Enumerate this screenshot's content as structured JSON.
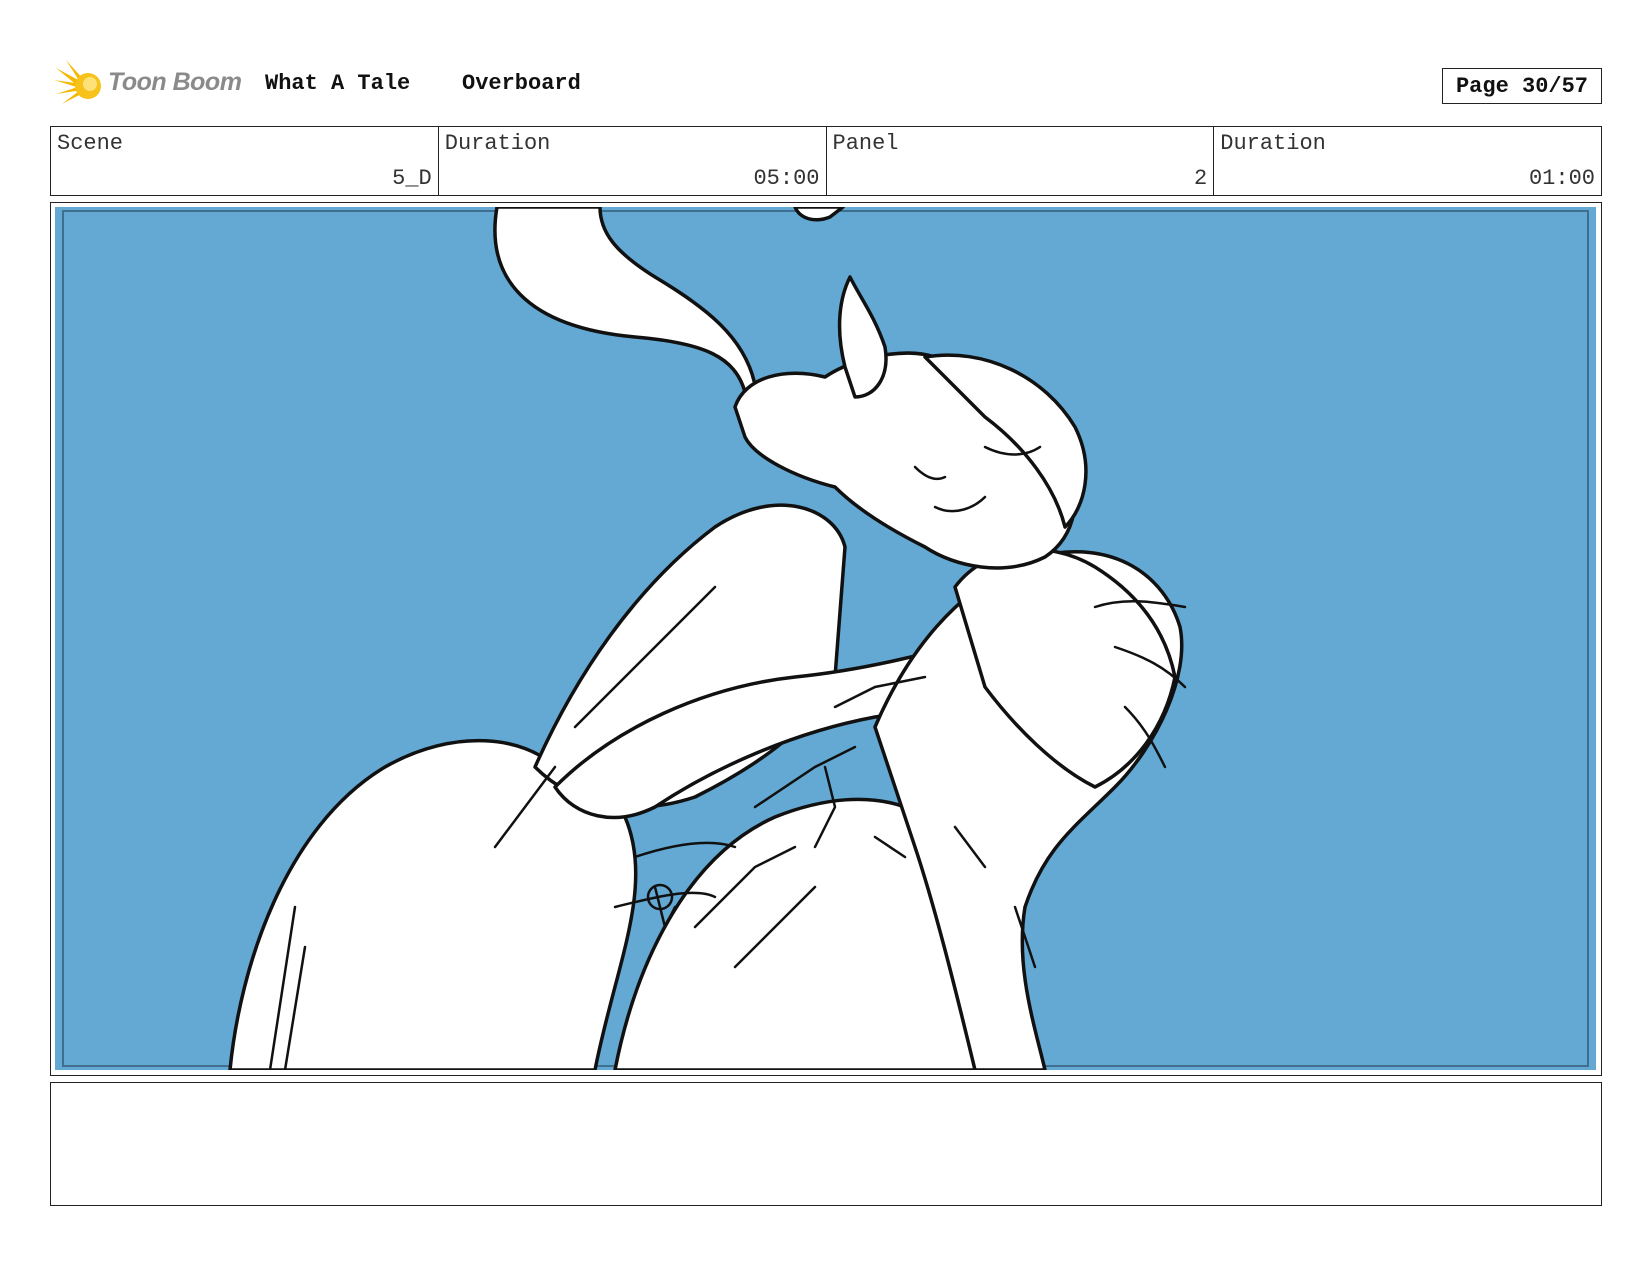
{
  "header": {
    "logo_text": "Toon Boom",
    "project_title": "What A Tale",
    "episode_title": "Overboard",
    "page_label": "Page 30/57"
  },
  "info": {
    "scene_label": "Scene",
    "scene_value": "5_D",
    "scene_duration_label": "Duration",
    "scene_duration_value": "05:00",
    "panel_label": "Panel",
    "panel_value": "2",
    "panel_duration_label": "Duration",
    "panel_duration_value": "01:00"
  },
  "panel": {
    "background_color": "#63a9d4",
    "sketch_color": "#111111",
    "fill_color": "#ffffff"
  },
  "notes": {
    "text": ""
  }
}
